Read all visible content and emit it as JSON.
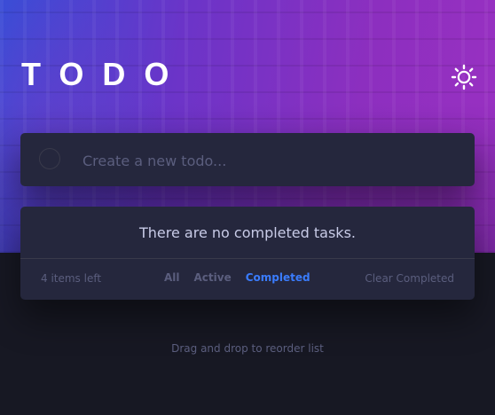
{
  "header": {
    "title": "TODO",
    "theme_icon": "sun-icon"
  },
  "create": {
    "placeholder": "Create a new todo..."
  },
  "list": {
    "empty_message": "There are no completed tasks."
  },
  "footer": {
    "items_left": "4 items left",
    "filters": [
      {
        "label": "All",
        "active": false
      },
      {
        "label": "Active",
        "active": false
      },
      {
        "label": "Completed",
        "active": true
      }
    ],
    "clear_label": "Clear Completed"
  },
  "hint": "Drag and drop to reorder list",
  "colors": {
    "background": "#171823",
    "card": "#25273d",
    "accent": "#3a7cfd",
    "text_muted": "#5b5e7e",
    "text": "#c8cbe7"
  }
}
